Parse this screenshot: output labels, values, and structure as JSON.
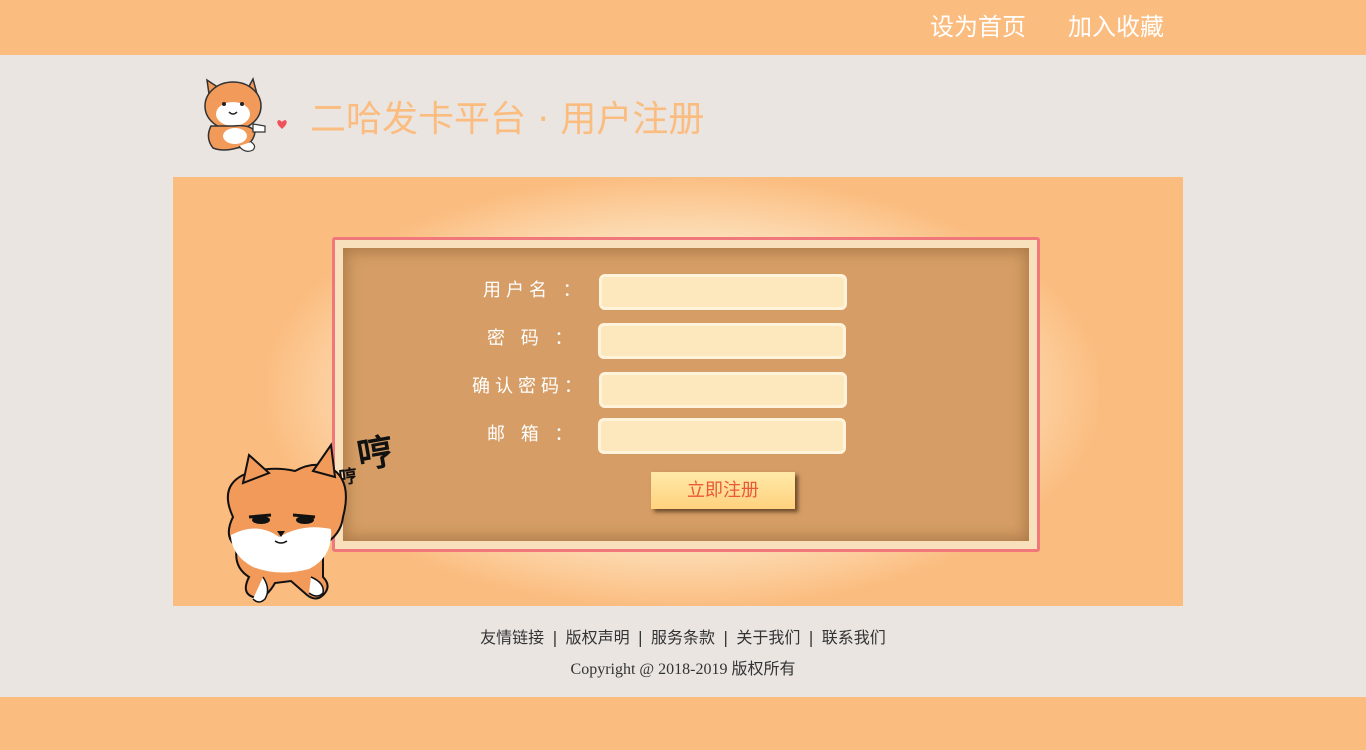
{
  "topbar": {
    "set_homepage": "设为首页",
    "add_favorite": "加入收藏",
    "background": "#FBBC7F"
  },
  "header": {
    "title": "二哈发卡平台 · 用户注册",
    "title_color": "#FBBC7F"
  },
  "form": {
    "username_label": "用户名 ：",
    "password_label": "密  码 ：",
    "confirm_label": "确认密码：",
    "email_label": "邮  箱 ：",
    "username_value": "",
    "password_value": "",
    "confirm_value": "",
    "email_value": "",
    "submit_label": "立即注册",
    "accent_border": "#F0787A"
  },
  "mascot": {
    "humph_big": "哼",
    "humph_small": "哼"
  },
  "footer": {
    "links": [
      "友情链接",
      "版权声明",
      "服务条款",
      "关于我们",
      "联系我们"
    ],
    "separator": "|",
    "copyright": "Copyright @ 2018-2019 版权所有"
  }
}
